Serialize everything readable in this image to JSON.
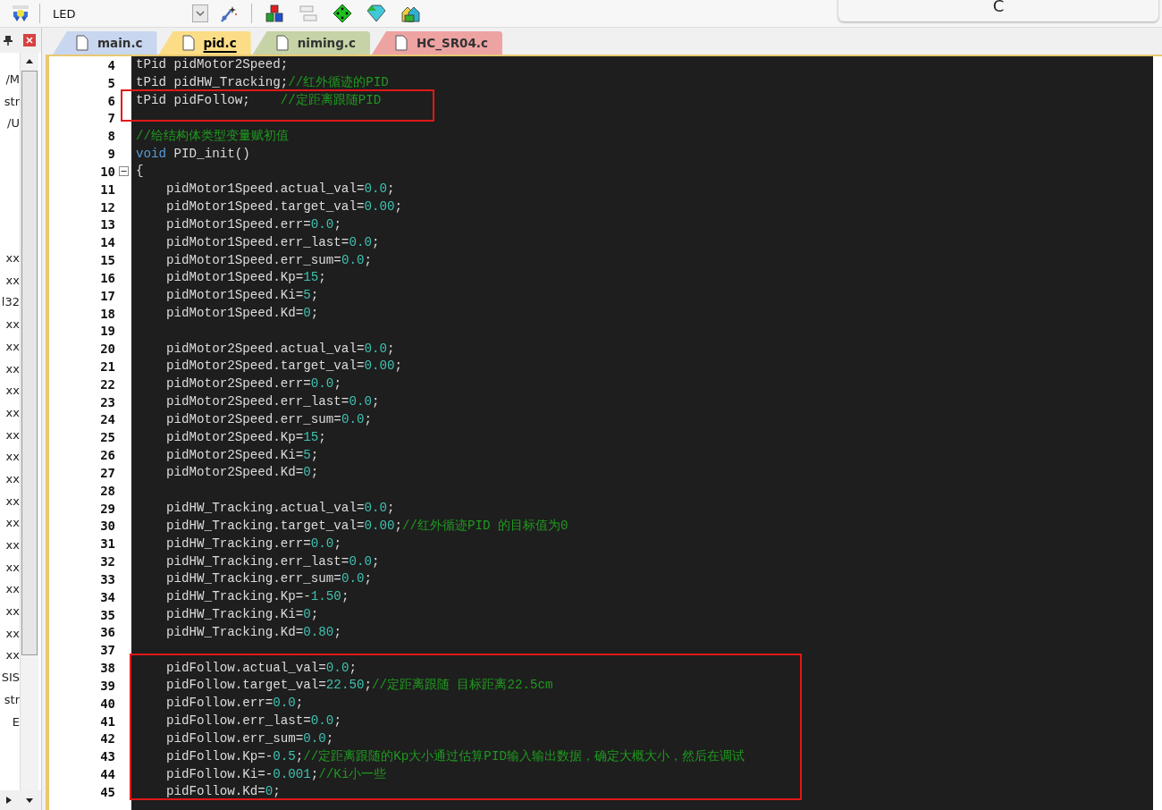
{
  "toolbar": {
    "target": "LED"
  },
  "popup": {
    "text": "C"
  },
  "project_panel": {
    "groups": [
      [
        "/M",
        "str",
        "/U"
      ],
      [
        "xx",
        "xx",
        "l32",
        "xx",
        "xx",
        "xx",
        "xx",
        "xx",
        "xx",
        "xx",
        "xx",
        "xx",
        "xx",
        "xx",
        "xx",
        "xx",
        "xx",
        "xx",
        "xx",
        "SIS",
        "str",
        "E"
      ]
    ]
  },
  "tabs": [
    {
      "label": "main.c",
      "selected": false,
      "color": "#c9d6ef"
    },
    {
      "label": "pid.c",
      "selected": true,
      "color": "#fbdd87"
    },
    {
      "label": "niming.c",
      "selected": false,
      "color": "#c5d3a6"
    },
    {
      "label": "HC_SR04.c",
      "selected": false,
      "color": "#eea3a3"
    }
  ],
  "editor": {
    "lines": [
      {
        "number": "4",
        "fold": false,
        "tokens": [
          {
            "kind": "plain",
            "text": "tPid pidMotor2Speed;"
          }
        ]
      },
      {
        "number": "5",
        "fold": false,
        "tokens": [
          {
            "kind": "plain",
            "text": "tPid pidHW_Tracking;"
          },
          {
            "kind": "comment",
            "text": "//红外循迹的PID"
          }
        ]
      },
      {
        "number": "6",
        "fold": false,
        "tokens": [
          {
            "kind": "plain",
            "text": "tPid pidFollow;    "
          },
          {
            "kind": "comment",
            "text": "//定距离跟随PID"
          }
        ]
      },
      {
        "number": "7",
        "fold": false
      },
      {
        "number": "8",
        "fold": false,
        "tokens": [
          {
            "kind": "comment",
            "text": "//给结构体类型变量赋初值"
          }
        ]
      },
      {
        "number": "9",
        "fold": false,
        "tokens": [
          {
            "kind": "keyword",
            "text": "void"
          },
          {
            "kind": "plain",
            "text": " PID_init()"
          }
        ]
      },
      {
        "number": "10",
        "fold": true,
        "tokens": [
          {
            "kind": "plain",
            "text": "{"
          }
        ]
      },
      {
        "number": "11",
        "fold": false,
        "tokens": [
          {
            "kind": "plain",
            "text": "    pidMotor1Speed.actual_val="
          },
          {
            "kind": "number",
            "text": "0.0"
          },
          {
            "kind": "plain",
            "text": ";"
          }
        ]
      },
      {
        "number": "12",
        "fold": false,
        "tokens": [
          {
            "kind": "plain",
            "text": "    pidMotor1Speed.target_val="
          },
          {
            "kind": "number",
            "text": "0.00"
          },
          {
            "kind": "plain",
            "text": ";"
          }
        ]
      },
      {
        "number": "13",
        "fold": false,
        "tokens": [
          {
            "kind": "plain",
            "text": "    pidMotor1Speed.err="
          },
          {
            "kind": "number",
            "text": "0.0"
          },
          {
            "kind": "plain",
            "text": ";"
          }
        ]
      },
      {
        "number": "14",
        "fold": false,
        "tokens": [
          {
            "kind": "plain",
            "text": "    pidMotor1Speed.err_last="
          },
          {
            "kind": "number",
            "text": "0.0"
          },
          {
            "kind": "plain",
            "text": ";"
          }
        ]
      },
      {
        "number": "15",
        "fold": false,
        "tokens": [
          {
            "kind": "plain",
            "text": "    pidMotor1Speed.err_sum="
          },
          {
            "kind": "number",
            "text": "0.0"
          },
          {
            "kind": "plain",
            "text": ";"
          }
        ]
      },
      {
        "number": "16",
        "fold": false,
        "tokens": [
          {
            "kind": "plain",
            "text": "    pidMotor1Speed.Kp="
          },
          {
            "kind": "number",
            "text": "15"
          },
          {
            "kind": "plain",
            "text": ";"
          }
        ]
      },
      {
        "number": "17",
        "fold": false,
        "tokens": [
          {
            "kind": "plain",
            "text": "    pidMotor1Speed.Ki="
          },
          {
            "kind": "number",
            "text": "5"
          },
          {
            "kind": "plain",
            "text": ";"
          }
        ]
      },
      {
        "number": "18",
        "fold": false,
        "tokens": [
          {
            "kind": "plain",
            "text": "    pidMotor1Speed.Kd="
          },
          {
            "kind": "number",
            "text": "0"
          },
          {
            "kind": "plain",
            "text": ";"
          }
        ]
      },
      {
        "number": "19",
        "fold": false
      },
      {
        "number": "20",
        "fold": false,
        "tokens": [
          {
            "kind": "plain",
            "text": "    pidMotor2Speed.actual_val="
          },
          {
            "kind": "number",
            "text": "0.0"
          },
          {
            "kind": "plain",
            "text": ";"
          }
        ]
      },
      {
        "number": "21",
        "fold": false,
        "tokens": [
          {
            "kind": "plain",
            "text": "    pidMotor2Speed.target_val="
          },
          {
            "kind": "number",
            "text": "0.00"
          },
          {
            "kind": "plain",
            "text": ";"
          }
        ]
      },
      {
        "number": "22",
        "fold": false,
        "tokens": [
          {
            "kind": "plain",
            "text": "    pidMotor2Speed.err="
          },
          {
            "kind": "number",
            "text": "0.0"
          },
          {
            "kind": "plain",
            "text": ";"
          }
        ]
      },
      {
        "number": "23",
        "fold": false,
        "tokens": [
          {
            "kind": "plain",
            "text": "    pidMotor2Speed.err_last="
          },
          {
            "kind": "number",
            "text": "0.0"
          },
          {
            "kind": "plain",
            "text": ";"
          }
        ]
      },
      {
        "number": "24",
        "fold": false,
        "tokens": [
          {
            "kind": "plain",
            "text": "    pidMotor2Speed.err_sum="
          },
          {
            "kind": "number",
            "text": "0.0"
          },
          {
            "kind": "plain",
            "text": ";"
          }
        ]
      },
      {
        "number": "25",
        "fold": false,
        "tokens": [
          {
            "kind": "plain",
            "text": "    pidMotor2Speed.Kp="
          },
          {
            "kind": "number",
            "text": "15"
          },
          {
            "kind": "plain",
            "text": ";"
          }
        ]
      },
      {
        "number": "26",
        "fold": false,
        "tokens": [
          {
            "kind": "plain",
            "text": "    pidMotor2Speed.Ki="
          },
          {
            "kind": "number",
            "text": "5"
          },
          {
            "kind": "plain",
            "text": ";"
          }
        ]
      },
      {
        "number": "27",
        "fold": false,
        "tokens": [
          {
            "kind": "plain",
            "text": "    pidMotor2Speed.Kd="
          },
          {
            "kind": "number",
            "text": "0"
          },
          {
            "kind": "plain",
            "text": ";"
          }
        ]
      },
      {
        "number": "28",
        "fold": false
      },
      {
        "number": "29",
        "fold": false,
        "tokens": [
          {
            "kind": "plain",
            "text": "    pidHW_Tracking.actual_val="
          },
          {
            "kind": "number",
            "text": "0.0"
          },
          {
            "kind": "plain",
            "text": ";"
          }
        ]
      },
      {
        "number": "30",
        "fold": false,
        "tokens": [
          {
            "kind": "plain",
            "text": "    pidHW_Tracking.target_val="
          },
          {
            "kind": "number",
            "text": "0.00"
          },
          {
            "kind": "plain",
            "text": ";"
          },
          {
            "kind": "comment",
            "text": "//红外循迹PID 的目标值为0"
          }
        ]
      },
      {
        "number": "31",
        "fold": false,
        "tokens": [
          {
            "kind": "plain",
            "text": "    pidHW_Tracking.err="
          },
          {
            "kind": "number",
            "text": "0.0"
          },
          {
            "kind": "plain",
            "text": ";"
          }
        ]
      },
      {
        "number": "32",
        "fold": false,
        "tokens": [
          {
            "kind": "plain",
            "text": "    pidHW_Tracking.err_last="
          },
          {
            "kind": "number",
            "text": "0.0"
          },
          {
            "kind": "plain",
            "text": ";"
          }
        ]
      },
      {
        "number": "33",
        "fold": false,
        "tokens": [
          {
            "kind": "plain",
            "text": "    pidHW_Tracking.err_sum="
          },
          {
            "kind": "number",
            "text": "0.0"
          },
          {
            "kind": "plain",
            "text": ";"
          }
        ]
      },
      {
        "number": "34",
        "fold": false,
        "tokens": [
          {
            "kind": "plain",
            "text": "    pidHW_Tracking.Kp=-"
          },
          {
            "kind": "number",
            "text": "1.50"
          },
          {
            "kind": "plain",
            "text": ";"
          }
        ]
      },
      {
        "number": "35",
        "fold": false,
        "tokens": [
          {
            "kind": "plain",
            "text": "    pidHW_Tracking.Ki="
          },
          {
            "kind": "number",
            "text": "0"
          },
          {
            "kind": "plain",
            "text": ";"
          }
        ]
      },
      {
        "number": "36",
        "fold": false,
        "tokens": [
          {
            "kind": "plain",
            "text": "    pidHW_Tracking.Kd="
          },
          {
            "kind": "number",
            "text": "0.80"
          },
          {
            "kind": "plain",
            "text": ";"
          }
        ]
      },
      {
        "number": "37",
        "fold": false
      },
      {
        "number": "38",
        "fold": false,
        "tokens": [
          {
            "kind": "plain",
            "text": "    pidFollow.actual_val="
          },
          {
            "kind": "number",
            "text": "0.0"
          },
          {
            "kind": "plain",
            "text": ";"
          }
        ]
      },
      {
        "number": "39",
        "fold": false,
        "tokens": [
          {
            "kind": "plain",
            "text": "    pidFollow.target_val="
          },
          {
            "kind": "number",
            "text": "22.50"
          },
          {
            "kind": "plain",
            "text": ";"
          },
          {
            "kind": "comment",
            "text": "//定距离跟随 目标距离22.5cm"
          }
        ]
      },
      {
        "number": "40",
        "fold": false,
        "tokens": [
          {
            "kind": "plain",
            "text": "    pidFollow.err="
          },
          {
            "kind": "number",
            "text": "0.0"
          },
          {
            "kind": "plain",
            "text": ";"
          }
        ]
      },
      {
        "number": "41",
        "fold": false,
        "tokens": [
          {
            "kind": "plain",
            "text": "    pidFollow.err_last="
          },
          {
            "kind": "number",
            "text": "0.0"
          },
          {
            "kind": "plain",
            "text": ";"
          }
        ]
      },
      {
        "number": "42",
        "fold": false,
        "tokens": [
          {
            "kind": "plain",
            "text": "    pidFollow.err_sum="
          },
          {
            "kind": "number",
            "text": "0.0"
          },
          {
            "kind": "plain",
            "text": ";"
          }
        ]
      },
      {
        "number": "43",
        "fold": false,
        "tokens": [
          {
            "kind": "plain",
            "text": "    pidFollow.Kp=-"
          },
          {
            "kind": "number",
            "text": "0.5"
          },
          {
            "kind": "plain",
            "text": ";"
          },
          {
            "kind": "comment",
            "text": "//定距离跟随的Kp大小通过估算PID输入输出数据，确定大概大小，然后在调试"
          }
        ]
      },
      {
        "number": "44",
        "fold": false,
        "tokens": [
          {
            "kind": "plain",
            "text": "    pidFollow.Ki=-"
          },
          {
            "kind": "number",
            "text": "0.001"
          },
          {
            "kind": "plain",
            "text": ";"
          },
          {
            "kind": "comment",
            "text": "//Ki小一些"
          }
        ]
      },
      {
        "number": "45",
        "fold": false,
        "tokens": [
          {
            "kind": "plain",
            "text": "    pidFollow.Kd="
          },
          {
            "kind": "number",
            "text": "0"
          },
          {
            "kind": "plain",
            "text": ";"
          }
        ]
      }
    ]
  }
}
